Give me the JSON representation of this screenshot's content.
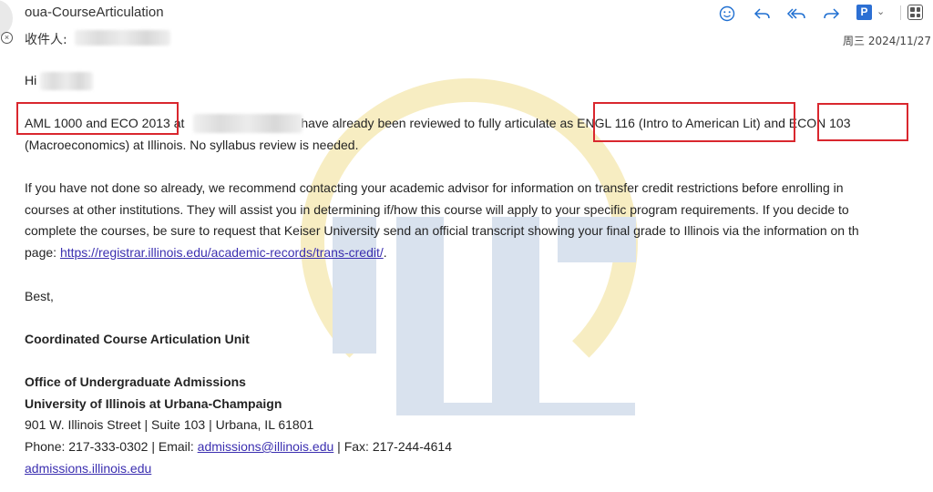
{
  "header": {
    "from": "oua-CourseArticulation",
    "to_label": "收件人:",
    "date": "周三 2024/11/27",
    "toolbar_icons": [
      "emoji-icon",
      "reply-icon",
      "reply-all-icon",
      "forward-icon",
      "p-app-icon",
      "chevron-down-icon",
      "apps-icon"
    ],
    "p_icon_letter": "P",
    "accent": "#1f6fd1"
  },
  "body": {
    "greeting": "Hi",
    "p1_courses": "AML 1000 and ECO 2013",
    "p1_at": " at",
    "p1_mid": "have already been reviewed to fully articulate as ",
    "p1_engl": "ENGL 116 (Intro to American Lit)",
    "p1_and": " and ",
    "p1_econ": "ECON 103",
    "p1_line2": "(Macroeconomics) at Illinois. No syllabus review is needed.",
    "p2_line1": "If you have not done so already, we recommend contacting your academic advisor for information on transfer credit restrictions before enrolling in",
    "p2_line2": "courses at other institutions. They will assist you in determining if/how this course will apply to your specific program requirements. If you decide to",
    "p2_line3": "complete the courses, be sure to request that Keiser University send an official transcript showing your final grade to Illinois via the information on th",
    "p2_page": "page: ",
    "p2_link": "https://registrar.illinois.edu/academic-records/trans-credit/",
    "p2_end": ".",
    "closing": "Best,",
    "unit": "Coordinated Course Articulation Unit",
    "office": "Office of Undergraduate Admissions",
    "university": "University of Illinois at Urbana-Champaign",
    "address": "901 W. Illinois Street | Suite 103 | Urbana, IL 61801",
    "phone_pre": "Phone: 217-333-0302 | Email: ",
    "email": "admissions@illinois.edu",
    "fax": " | Fax: 217-244-4614",
    "site": "admissions.illinois.edu"
  },
  "highlight_color": "#d9272e"
}
